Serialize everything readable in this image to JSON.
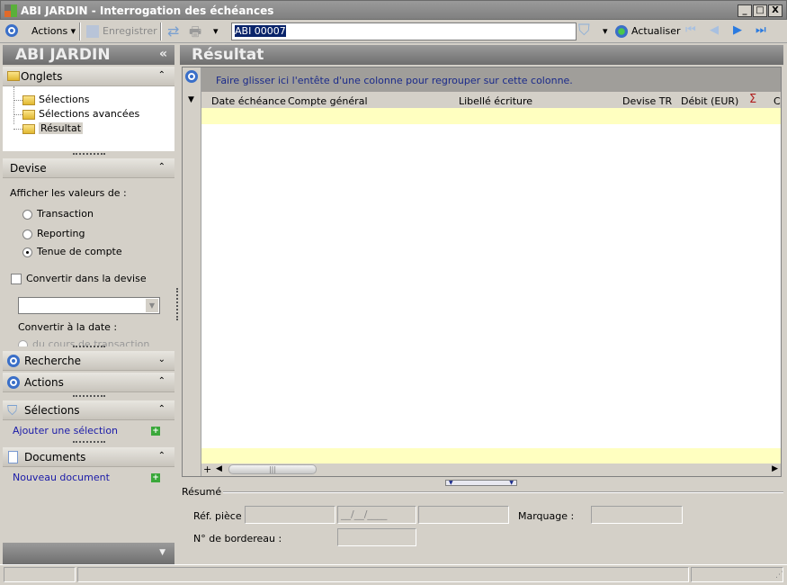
{
  "window": {
    "title": "ABI JARDIN -  Interrogation des échéances",
    "minimize": "_",
    "maximize": "□",
    "close": "X"
  },
  "toolbar": {
    "actions_label": "Actions",
    "save_label": "Enregistrer",
    "record_field_value": "ABI 00007",
    "refresh_label": "Actualiser"
  },
  "sidebar": {
    "title": "ABI JARDIN",
    "collapse": "«",
    "onglets": {
      "label": "Onglets",
      "items": [
        {
          "label": "Sélections"
        },
        {
          "label": "Sélections avancées"
        },
        {
          "label": "Résultat",
          "selected": true
        }
      ]
    },
    "devise": {
      "label": "Devise",
      "show_values_label": "Afficher les valeurs de :",
      "options": [
        {
          "label": "Transaction",
          "checked": false
        },
        {
          "label": "Reporting",
          "checked": false
        },
        {
          "label": "Tenue de compte",
          "checked": true
        }
      ],
      "convert_checkbox": "Convertir dans la devise",
      "convert_checked": false,
      "currency_value": "",
      "convert_date_label": "Convertir à la date :",
      "cut_option": "du cours de transaction"
    },
    "recherche": {
      "label": "Recherche"
    },
    "actions": {
      "label": "Actions"
    },
    "selections": {
      "label": "Sélections",
      "link": "Ajouter une sélection"
    },
    "documents": {
      "label": "Documents",
      "link": "Nouveau document"
    }
  },
  "main": {
    "title": "Résultat",
    "group_hint": "Faire glisser ici l'entête d'une colonne pour regrouper sur cette colonne.",
    "columns": [
      "Date échéance",
      "Compte général",
      "Libellé écriture",
      "Devise TR",
      "Débit (EUR)",
      "Σ",
      "C"
    ],
    "add_btn": "+"
  },
  "summary": {
    "legend": "Résumé",
    "ref_piece_label": "Réf. pièce :",
    "date_placeholder": "__/__/____",
    "marquage_label": "Marquage :",
    "bordereau_label": "N° de bordereau :"
  },
  "colors": {
    "accent": "#3a6fc8",
    "row_highlight": "#ffffc0",
    "link": "#1a1aa8"
  }
}
